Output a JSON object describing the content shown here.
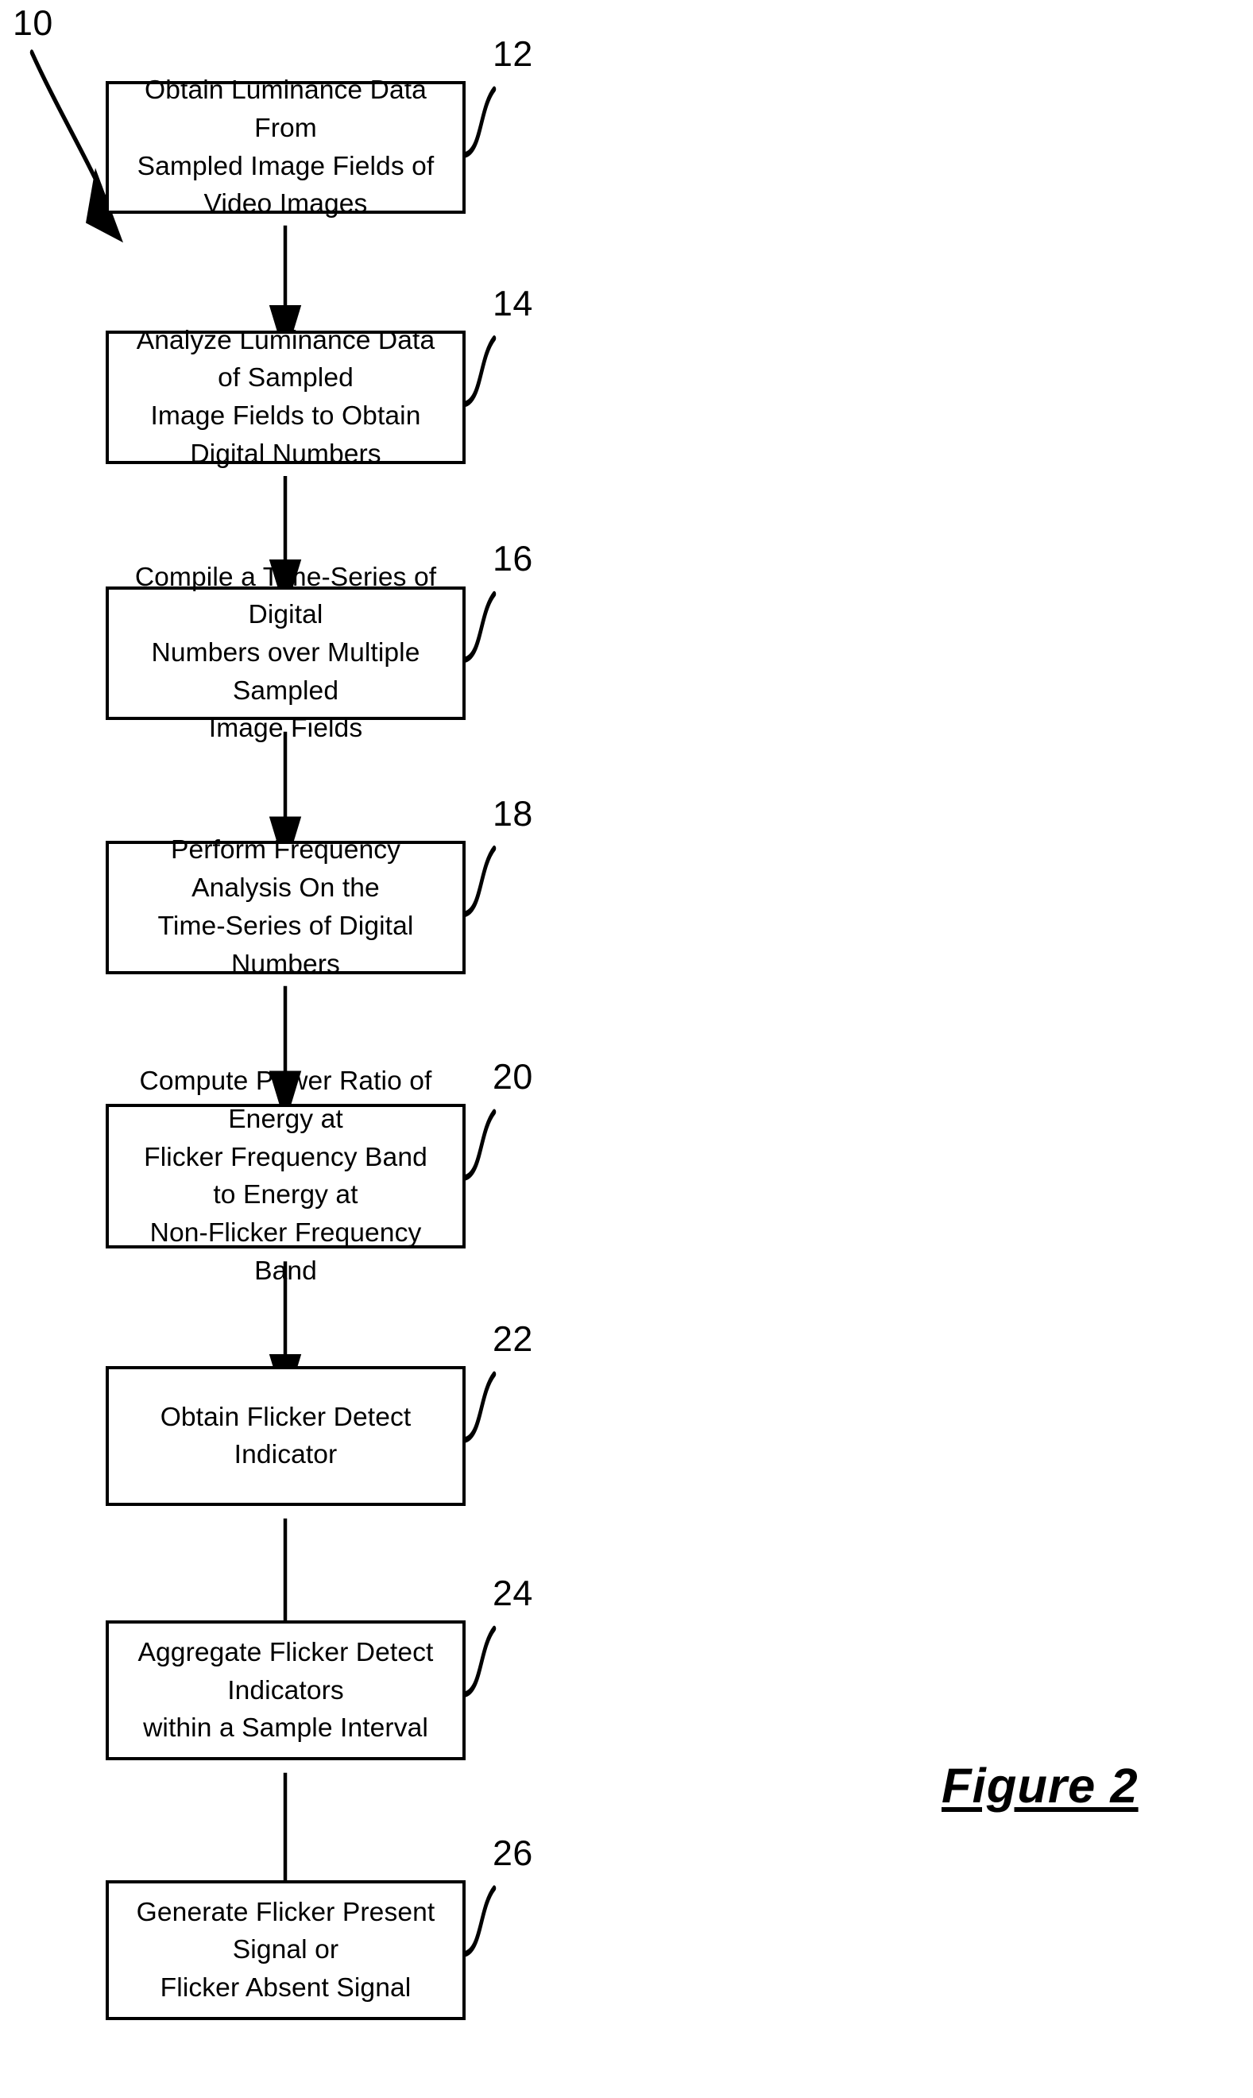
{
  "figure": {
    "caption": "Figure 2",
    "diagram_label": "10"
  },
  "steps": [
    {
      "ref": "12",
      "text": "Obtain Luminance Data From\nSampled Image Fields of Video Images"
    },
    {
      "ref": "14",
      "text": "Analyze Luminance Data of Sampled\nImage Fields to Obtain Digital Numbers"
    },
    {
      "ref": "16",
      "text": "Compile a Time-Series of Digital\nNumbers over Multiple Sampled\nImage Fields"
    },
    {
      "ref": "18",
      "text": "Perform Frequency Analysis On the\nTime-Series of Digital Numbers"
    },
    {
      "ref": "20",
      "text": "Compute Power Ratio of Energy at\nFlicker Frequency Band to Energy at\nNon-Flicker Frequency Band"
    },
    {
      "ref": "22",
      "text": "Obtain Flicker Detect Indicator"
    },
    {
      "ref": "24",
      "text": "Aggregate Flicker Detect Indicators\nwithin a Sample Interval"
    },
    {
      "ref": "26",
      "text": "Generate Flicker Present Signal or\nFlicker Absent Signal"
    }
  ],
  "colors": {
    "stroke": "#000000",
    "background": "#ffffff"
  }
}
